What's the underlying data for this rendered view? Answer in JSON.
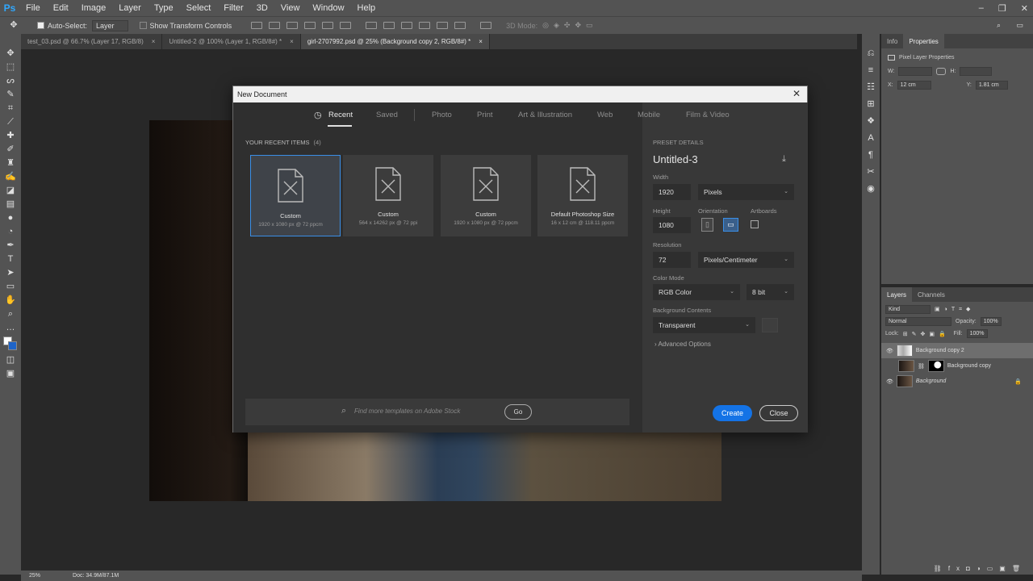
{
  "app": {
    "logo": "Ps"
  },
  "menu": [
    "File",
    "Edit",
    "Image",
    "Layer",
    "Type",
    "Select",
    "Filter",
    "3D",
    "View",
    "Window",
    "Help"
  ],
  "window_controls": [
    "–",
    "❐",
    "✕"
  ],
  "options_bar": {
    "auto_select_label": "Auto-Select:",
    "auto_select_value": "Layer",
    "show_transform_label": "Show Transform Controls",
    "mode_3d_label": "3D Mode:"
  },
  "doc_tabs": [
    {
      "label": "test_03.psd @ 66.7% (Layer 17, RGB/8)",
      "active": false
    },
    {
      "label": "Untitled-2 @ 100% (Layer 1, RGB/8#) *",
      "active": false
    },
    {
      "label": "girl-2707992.psd @ 25% (Background copy 2, RGB/8#) *",
      "active": true
    }
  ],
  "properties_panel": {
    "tabs": [
      "Info",
      "Properties"
    ],
    "section": "Pixel Layer Properties",
    "w_label": "W:",
    "h_label": "H:",
    "x_label": "X:",
    "x_value": "12 cm",
    "y_label": "Y:",
    "y_value": "1.81 cm"
  },
  "layers_panel": {
    "tabs": [
      "Layers",
      "Channels"
    ],
    "kind": "Kind",
    "blend_mode": "Normal",
    "opacity_label": "Opacity:",
    "opacity_value": "100%",
    "lock_label": "Lock:",
    "fill_label": "Fill:",
    "fill_value": "100%",
    "layers": [
      {
        "name": "Background copy 2",
        "visible": true,
        "selected": true
      },
      {
        "name": "Background copy",
        "visible": false,
        "selected": false
      },
      {
        "name": "Background",
        "visible": true,
        "selected": false,
        "locked": true
      }
    ]
  },
  "status": {
    "zoom": "25%",
    "doc": "Doc: 34.9M/87.1M"
  },
  "dialog": {
    "title": "New Document",
    "tabs": [
      "Recent",
      "Saved",
      "Photo",
      "Print",
      "Art & Illustration",
      "Web",
      "Mobile",
      "Film & Video"
    ],
    "active_tab": "Recent",
    "recent_heading": "YOUR RECENT ITEMS",
    "recent_count": "(4)",
    "recent_items": [
      {
        "name": "Custom",
        "detail": "1920 x 1080 px @ 72 ppcm",
        "selected": true
      },
      {
        "name": "Custom",
        "detail": "564 x 14262 px @ 72 ppi",
        "selected": false
      },
      {
        "name": "Custom",
        "detail": "1920 x 1080 px @ 72 ppcm",
        "selected": false
      },
      {
        "name": "Default Photoshop Size",
        "detail": "16 x 12 cm @ 118.11 ppcm",
        "selected": false
      }
    ],
    "search_placeholder": "Find more templates on Adobe Stock",
    "go_label": "Go",
    "preset": {
      "heading": "PRESET DETAILS",
      "name": "Untitled-3",
      "width_label": "Width",
      "width_value": "1920",
      "width_unit": "Pixels",
      "height_label": "Height",
      "height_value": "1080",
      "orientation_label": "Orientation",
      "artboards_label": "Artboards",
      "resolution_label": "Resolution",
      "resolution_value": "72",
      "resolution_unit": "Pixels/Centimeter",
      "color_mode_label": "Color Mode",
      "color_mode": "RGB Color",
      "bit_depth": "8 bit",
      "background_label": "Background Contents",
      "background": "Transparent",
      "advanced_label": "Advanced Options"
    },
    "create_label": "Create",
    "close_label": "Close",
    "colors": {
      "accent": "#1473e6",
      "selected_border": "#3a8ee6"
    }
  }
}
